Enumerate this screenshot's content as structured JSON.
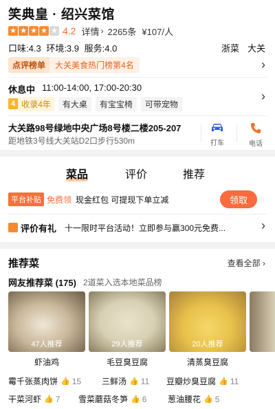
{
  "shop": {
    "name": "笑典皇 · 绍兴菜馆",
    "rating": "4.2",
    "rating_value": 4.2,
    "details_label": "详情",
    "reviews": "2265条",
    "price": "¥107/人",
    "taste": "口味:4.3",
    "environment": "环境:3.9",
    "service": "服务:4.0",
    "tags": [
      "浙菜",
      "大关"
    ],
    "rank_badge": "点评榜单",
    "rank_text": "大关美食热门榜第4名",
    "status": "休息中",
    "hours": "11:00-14:00, 17:00-20:30",
    "years_num": "4",
    "years_text": "收录4年",
    "features": [
      "有大桌",
      "有宝宝椅",
      "可带宠物"
    ],
    "address": "大关路98号绿地中央广场8号楼二楼205-207",
    "subway": "距地铁3号线大关站D2口步行530m",
    "taxi_label": "打车",
    "phone_label": "电话"
  },
  "tabs": [
    "菜品",
    "评价",
    "推荐"
  ],
  "promo": {
    "badge": "平台补贴",
    "free": "免费领",
    "text": "现金红包 可提现下单立减",
    "claim": "领取"
  },
  "gift": {
    "title": "评价有礼",
    "text": "十一限时平台活动！立即参与赢300元免费..."
  },
  "recommended": {
    "title": "推荐菜",
    "view_all": "查看全部",
    "subtitle": "网友推荐菜 (175)",
    "sub_note": "2道菜入选本地菜品榜",
    "dishes": [
      {
        "name": "虾油鸡",
        "count": "47人推荐",
        "color": "#c9b89a"
      },
      {
        "name": "毛豆臭豆腐",
        "count": "29人推荐",
        "color": "#d8d0b4"
      },
      {
        "name": "清蒸臭豆腐",
        "count": "20人推荐",
        "color": "#e8c14a"
      }
    ],
    "more": [
      {
        "name": "霉千张蒸肉饼",
        "likes": "15"
      },
      {
        "name": "三鲜汤",
        "likes": "11"
      },
      {
        "name": "豆瓣炒臭豆腐",
        "likes": "11"
      },
      {
        "name": "干菜河虾",
        "likes": "7"
      },
      {
        "name": "雪菜蘑菇冬笋",
        "likes": "6"
      },
      {
        "name": "葱油腰花",
        "likes": "5"
      }
    ]
  },
  "colors": {
    "accent": "#fa6b1f",
    "star": "#fa8a2f",
    "claim": "#fa6b3e"
  }
}
